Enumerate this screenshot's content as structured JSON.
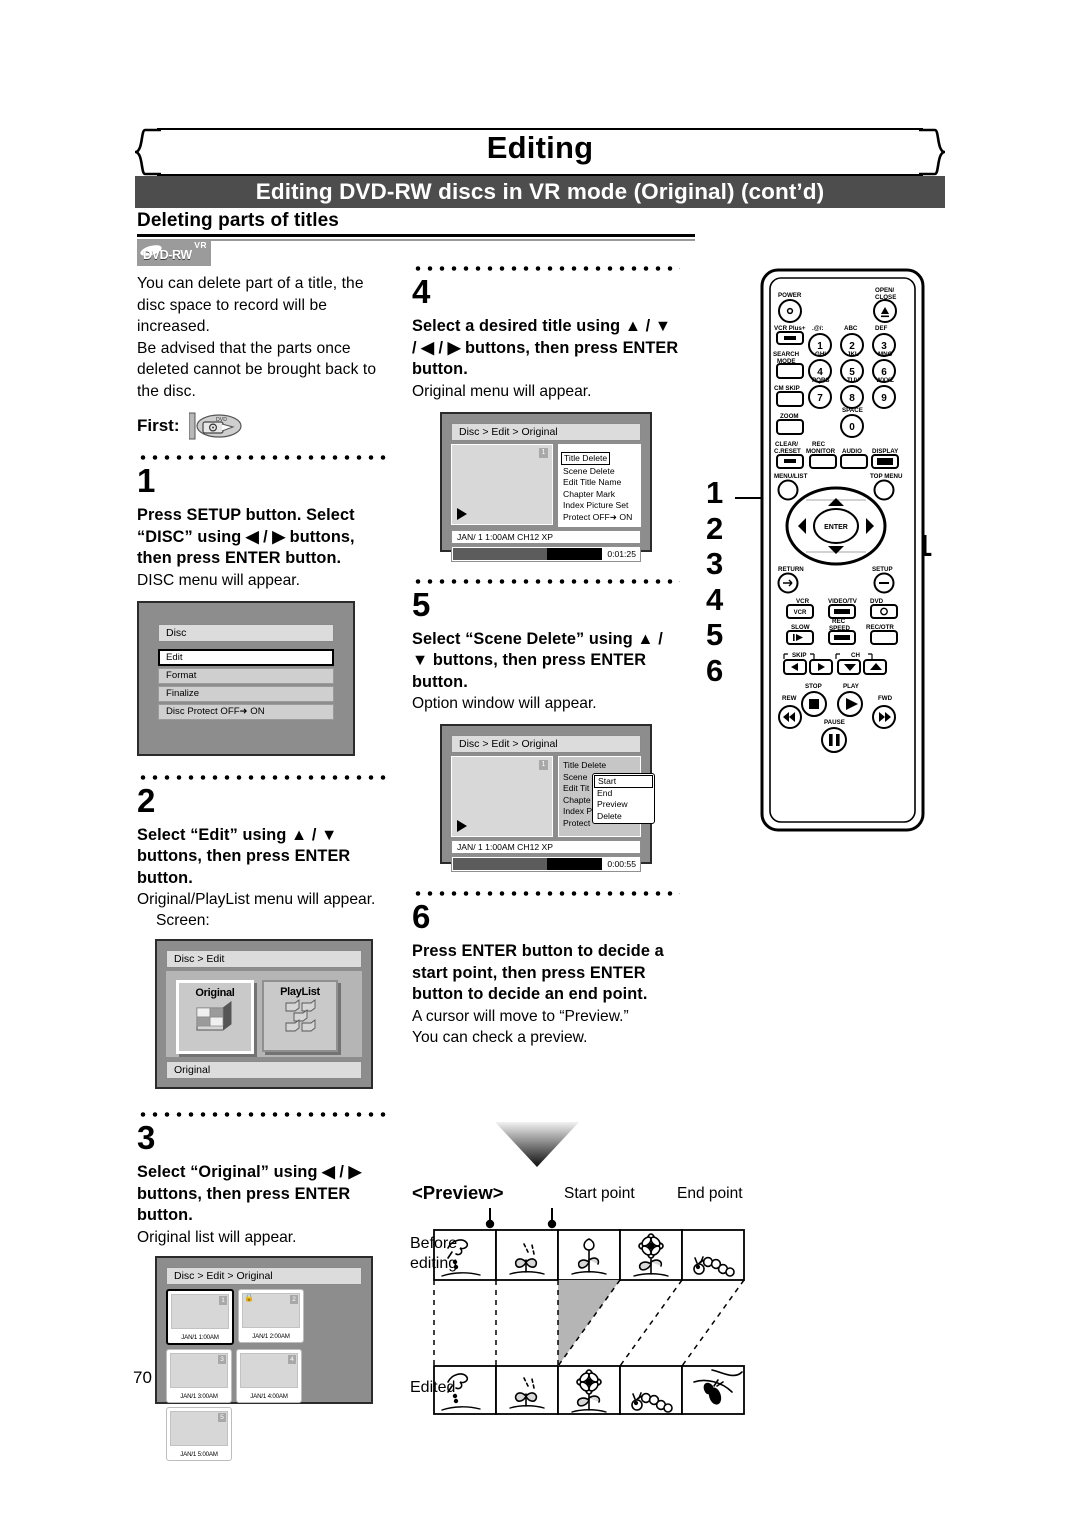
{
  "page": {
    "chapter_title": "Editing",
    "section_title": "Editing DVD-RW discs in VR mode (Original) (cont’d)",
    "subhead": "Deleting parts of titles",
    "page_number": "70"
  },
  "disc_logo": {
    "format": "DVD-RW",
    "mode": "VR"
  },
  "intro": {
    "p1": "You can delete part of a title, the disc space to record will be increased.",
    "p2": "Be advised that the parts once deleted cannot be brought back to the disc.",
    "first_label": "First:",
    "first_icon": "insert-disc-icon"
  },
  "steps": [
    {
      "number": "1",
      "bold": "Press SETUP button. Select “DISC” using ◀ / ▶ buttons, then press ENTER button.",
      "note": "DISC menu will appear."
    },
    {
      "number": "2",
      "bold": "Select “Edit” using ▲ / ▼ buttons, then press ENTER button.",
      "note": "Original/PlayList menu will appear.",
      "note2": "Screen:"
    },
    {
      "number": "3",
      "bold": "Select “Original” using ◀ / ▶ buttons, then press ENTER button.",
      "note": "Original list will appear."
    },
    {
      "number": "4",
      "bold": "Select a desired title using ▲ / ▼ / ◀ / ▶ buttons, then press ENTER button.",
      "note": "Original menu will appear."
    },
    {
      "number": "5",
      "bold": "Select “Scene Delete” using ▲ / ▼ buttons, then press ENTER button.",
      "note": "Option window will appear."
    },
    {
      "number": "6",
      "bold": "Press ENTER button to decide a start point, then press ENTER button to decide an end point.",
      "note": "A cursor will move to “Preview.”",
      "note2": "You can check a preview."
    }
  ],
  "screen_disc_menu": {
    "title": "Disc",
    "items": [
      {
        "label": "Edit",
        "selected": true
      },
      {
        "label": "Format",
        "selected": false
      },
      {
        "label": "Finalize",
        "selected": false
      },
      {
        "label": "Disc Protect OFF➜ ON",
        "selected": false
      }
    ]
  },
  "screen_edit_menu": {
    "breadcrumb": "Disc > Edit",
    "tile_original": "Original",
    "tile_playlist": "PlayList",
    "status": "Original"
  },
  "screen_original_list": {
    "breadcrumb": "Disc > Edit > Original",
    "thumbs": [
      {
        "no": "1",
        "caption": "JAN/1  1:00AM",
        "selected": true,
        "locked": false
      },
      {
        "no": "2",
        "caption": "JAN/1  2:00AM",
        "selected": false,
        "locked": true
      },
      {
        "no": "3",
        "caption": "JAN/1  3:00AM",
        "selected": false,
        "locked": false
      },
      {
        "no": "4",
        "caption": "JAN/1  4:00AM",
        "selected": false,
        "locked": false
      },
      {
        "no": "5",
        "caption": "JAN/1  5:00AM",
        "selected": false,
        "locked": false
      }
    ]
  },
  "screen_original_menu": {
    "breadcrumb": "Disc > Edit > Original",
    "thumb_no": "1",
    "items": [
      "Title Delete",
      "Scene Delete",
      "Edit Title Name",
      "Chapter Mark",
      "Index Picture Set",
      "Protect OFF➜ ON"
    ],
    "selected_item": "Title Delete",
    "info": "JAN/ 1   1:00AM  CH12     XP",
    "time": "0:01:25"
  },
  "screen_scene_delete": {
    "breadcrumb": "Disc > Edit > Original",
    "thumb_no": "1",
    "items": [
      "Title Delete",
      "Scene",
      "Edit Tit",
      "Chapte",
      "Index P",
      "Protect"
    ],
    "option_window": [
      "Start",
      "End",
      "Preview",
      "Delete"
    ],
    "option_selected": "Start",
    "info": "JAN/ 1   1:00AM  CH12     XP",
    "time": "0:00:55"
  },
  "preview": {
    "heading": "<Preview>",
    "start_point": "Start point",
    "end_point": "End point",
    "row1_label_line1": "Before",
    "row1_label_line2": "editing",
    "row2_label": "Edited",
    "before_frames": [
      "seed-sprinkle-icon",
      "sprout-icon",
      "bud-icon",
      "flower-icon",
      "caterpillar-icon"
    ],
    "edited_frames": [
      "seed-sprinkle-icon",
      "sprout-icon",
      "flower-icon",
      "caterpillar-icon",
      "butterfly-icon"
    ]
  },
  "remote": {
    "callouts": [
      "1",
      "2",
      "3",
      "4",
      "5",
      "6"
    ],
    "callout_right": "1",
    "labels": {
      "power": "POWER",
      "open_close": "OPEN/\nCLOSE",
      "vcr_plus": "VCR Plus+",
      "search_mode": "SEARCH\nMODE",
      "cm_skip": "CM SKIP",
      "zoom": "ZOOM",
      "clear_reset": "CLEAR/\nC.RESET",
      "rec_monitor": "REC\nMONITOR",
      "audio": "AUDIO",
      "display": "DISPLAY",
      "menu_list": "MENU/LIST",
      "top_menu": "TOP MENU",
      "enter": "ENTER",
      "return": "RETURN",
      "setup": "SETUP",
      "vcr": "VCR",
      "video_tv": "VIDEO/TV",
      "dvd": "DVD",
      "slow": "SLOW",
      "rec_speed": "REC\nSPEED",
      "rec_otr": "REC/OTR",
      "skip": "SKIP",
      "ch": "CH",
      "stop": "STOP",
      "play": "PLAY",
      "rew": "REW",
      "fwd": "FWD",
      "pause": "PAUSE"
    },
    "keypad": [
      {
        "num": "1",
        "letters": ".@/:"
      },
      {
        "num": "2",
        "letters": "ABC"
      },
      {
        "num": "3",
        "letters": "DEF"
      },
      {
        "num": "4",
        "letters": "GHI"
      },
      {
        "num": "5",
        "letters": "JKL"
      },
      {
        "num": "6",
        "letters": "MNO"
      },
      {
        "num": "7",
        "letters": "PQRS"
      },
      {
        "num": "8",
        "letters": "TUV"
      },
      {
        "num": "9",
        "letters": "WXYZ"
      },
      {
        "num": "0",
        "letters": "SPACE"
      }
    ]
  },
  "colors": {
    "band": "#4d4d4d",
    "tv_bg": "#8d8d8d",
    "accent": "#000000"
  }
}
